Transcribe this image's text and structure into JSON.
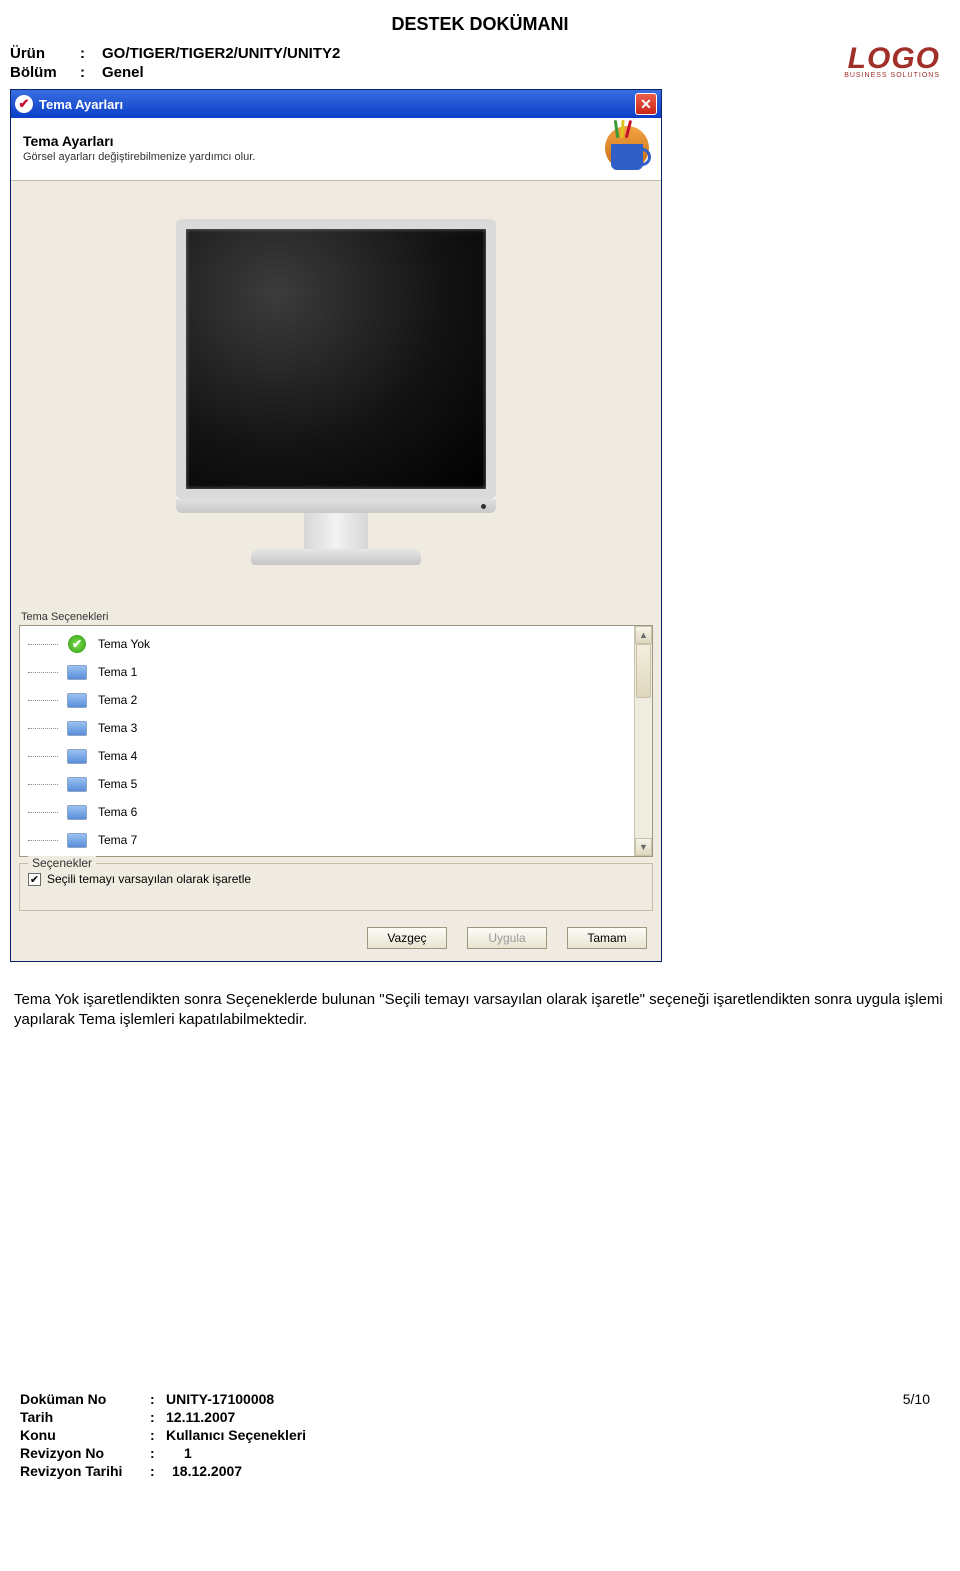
{
  "doc": {
    "title": "DESTEK DOKÜMANI",
    "product_label": "Ürün",
    "product_value": "GO/TIGER/TIGER2/UNITY/UNITY2",
    "section_label": "Bölüm",
    "section_value": "Genel"
  },
  "brand": {
    "logo_text": "LOGO",
    "logo_sub": "BUSINESS  SOLUTIONS"
  },
  "dialog": {
    "window_title": "Tema Ayarları",
    "banner_heading": "Tema Ayarları",
    "banner_desc": "Görsel ayarları değiştirebilmenize yardımcı olur.",
    "list_label": "Tema Seçenekleri",
    "themes": [
      {
        "label": "Tema Yok",
        "selected": true
      },
      {
        "label": "Tema 1",
        "selected": false
      },
      {
        "label": "Tema 2",
        "selected": false
      },
      {
        "label": "Tema 3",
        "selected": false
      },
      {
        "label": "Tema 4",
        "selected": false
      },
      {
        "label": "Tema 5",
        "selected": false
      },
      {
        "label": "Tema 6",
        "selected": false
      },
      {
        "label": "Tema 7",
        "selected": false
      }
    ],
    "options_legend": "Seçenekler",
    "option_default": "Seçili temayı varsayılan olarak işaretle",
    "option_default_checked": true,
    "buttons": {
      "cancel": "Vazgeç",
      "apply": "Uygula",
      "ok": "Tamam"
    }
  },
  "paragraph": "Tema Yok işaretlendikten sonra Seçeneklerde bulunan \"Seçili temayı varsayılan olarak işaretle\" seçeneği işaretlendikten sonra uygula işlemi yapılarak Tema işlemleri kapatılabilmektedir.",
  "footer": {
    "doc_no_label": "Doküman No",
    "doc_no": "UNITY-17100008",
    "date_label": "Tarih",
    "date": "12.11.2007",
    "topic_label": "Konu",
    "topic": "Kullanıcı Seçenekleri",
    "rev_no_label": "Revizyon No",
    "rev_no": "1",
    "rev_date_label": "Revizyon Tarihi",
    "rev_date": "18.12.2007",
    "page_number": "5/10"
  }
}
